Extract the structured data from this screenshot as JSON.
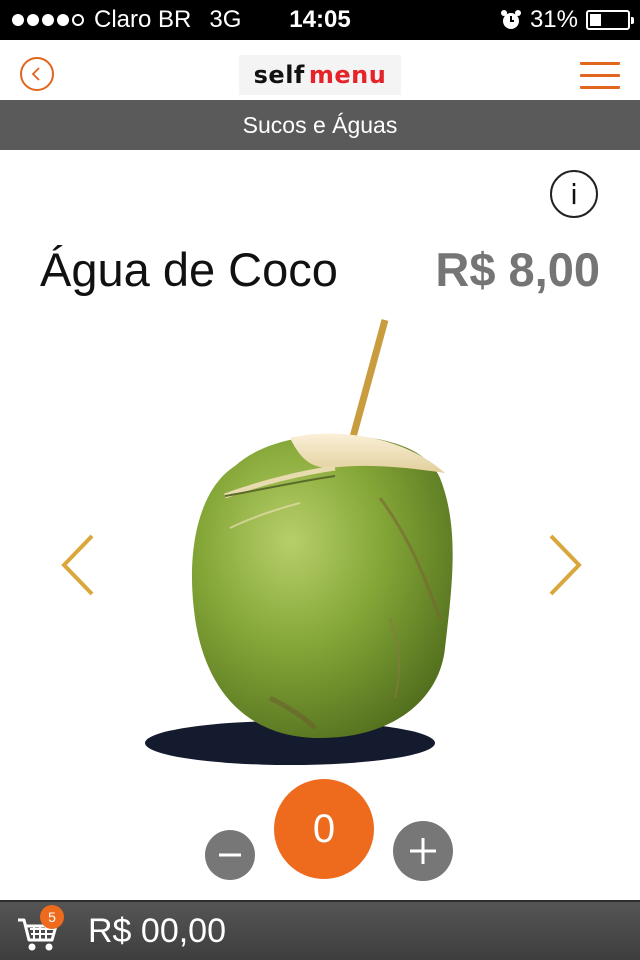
{
  "status_bar": {
    "carrier": "Claro BR",
    "network": "3G",
    "time": "14:05",
    "battery": "31%",
    "battery_level": 0.31,
    "signal_bars": 4
  },
  "nav": {
    "back_icon": "chevron-left-circle-icon",
    "logo_self": "self",
    "logo_menu": "menu",
    "menu_icon": "hamburger-icon"
  },
  "category": "Sucos e Águas",
  "product": {
    "name": "Água de Coco",
    "price": "R$ 8,00",
    "image": "coconut-with-straw",
    "info_icon": "info-icon"
  },
  "quantity": {
    "value": "0",
    "minus_icon": "minus-icon",
    "plus_icon": "plus-icon"
  },
  "cart": {
    "icon": "cart-icon",
    "count": "5",
    "total": "R$ 00,00"
  },
  "colors": {
    "accent": "#ee6a1d",
    "arrow": "#d9a73b",
    "band": "#5a5a5a",
    "price": "#757575"
  }
}
